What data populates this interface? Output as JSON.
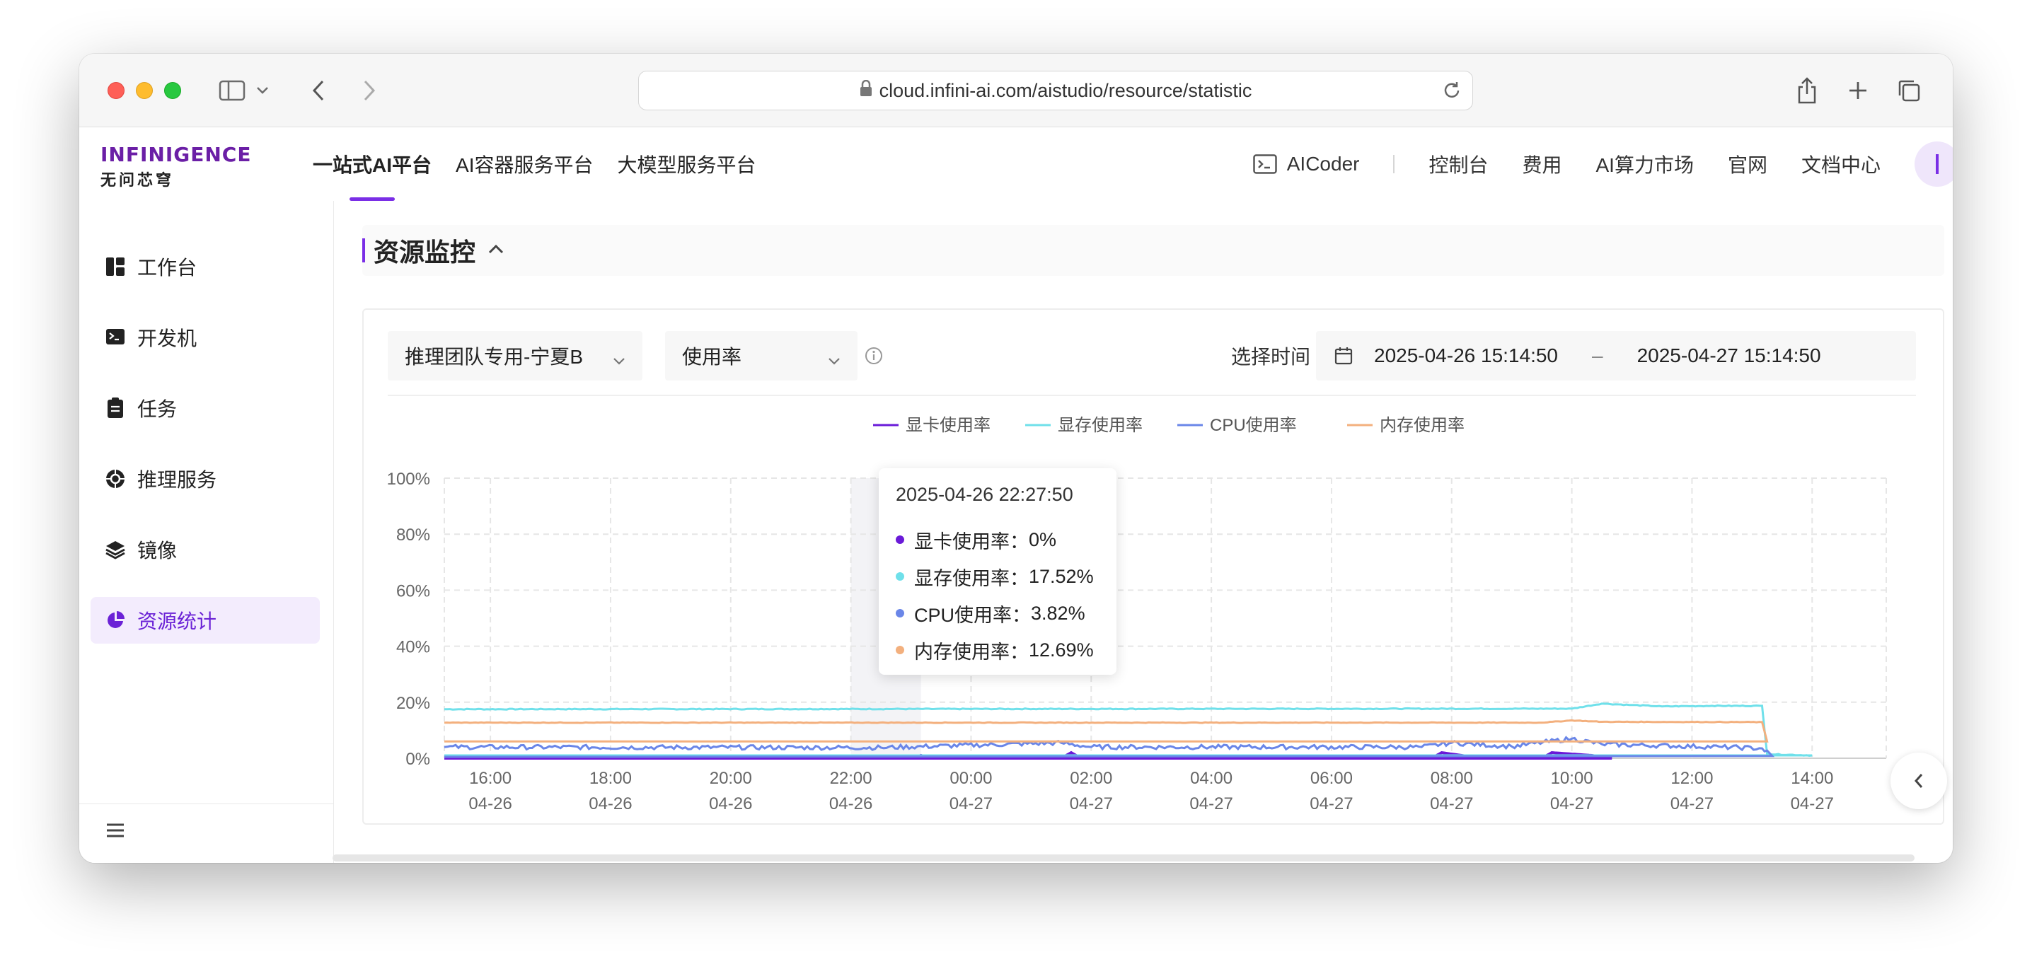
{
  "browser": {
    "url": "cloud.infini-ai.com/aistudio/resource/statistic"
  },
  "header": {
    "logo_main": "INFINIGENCE",
    "logo_sub": "无问芯穹",
    "nav": [
      "一站式AI平台",
      "AI容器服务平台",
      "大模型服务平台"
    ],
    "aicoder": "AICoder",
    "right_links": [
      "控制台",
      "费用",
      "AI算力市场",
      "官网",
      "文档中心"
    ]
  },
  "sidebar": {
    "items": [
      {
        "label": "工作台",
        "icon": "dashboard-icon"
      },
      {
        "label": "开发机",
        "icon": "terminal-icon"
      },
      {
        "label": "任务",
        "icon": "clipboard-icon"
      },
      {
        "label": "推理服务",
        "icon": "inference-icon"
      },
      {
        "label": "镜像",
        "icon": "layers-icon"
      },
      {
        "label": "资源统计",
        "icon": "pie-chart-icon"
      }
    ]
  },
  "section": {
    "title": "资源监控"
  },
  "filters": {
    "cluster": "推理团队专用-宁夏B",
    "metric": "使用率",
    "time_label": "选择时间",
    "start": "2025-04-26 15:14:50",
    "end": "2025-04-27 15:14:50"
  },
  "tooltip": {
    "time": "2025-04-26 22:27:50",
    "rows": [
      {
        "label": "显卡使用率：",
        "value": "0%"
      },
      {
        "label": "显存使用率：",
        "value": "17.52%"
      },
      {
        "label": "CPU使用率：",
        "value": "3.82%"
      },
      {
        "label": "内存使用率：",
        "value": "12.69%"
      }
    ]
  },
  "colors": {
    "accent": "#7a2ee6",
    "gpu": "#6a1ad8",
    "vram": "#6fe0ea",
    "cpu": "#6a86e8",
    "mem": "#f3b07e"
  },
  "chart_data": {
    "type": "line",
    "title": "",
    "xlabel": "",
    "ylabel": "",
    "ylim": [
      0,
      100
    ],
    "y_ticks": [
      "0%",
      "20%",
      "40%",
      "60%",
      "80%",
      "100%"
    ],
    "x_ticks": [
      {
        "time": "16:00",
        "date": "04-26"
      },
      {
        "time": "18:00",
        "date": "04-26"
      },
      {
        "time": "20:00",
        "date": "04-26"
      },
      {
        "time": "22:00",
        "date": "04-26"
      },
      {
        "time": "00:00",
        "date": "04-27"
      },
      {
        "time": "02:00",
        "date": "04-27"
      },
      {
        "time": "04:00",
        "date": "04-27"
      },
      {
        "time": "06:00",
        "date": "04-27"
      },
      {
        "time": "08:00",
        "date": "04-27"
      },
      {
        "time": "10:00",
        "date": "04-27"
      },
      {
        "time": "12:00",
        "date": "04-27"
      },
      {
        "time": "14:00",
        "date": "04-27"
      }
    ],
    "legend_position": "top-center",
    "grid": true,
    "series": [
      {
        "name": "显卡使用率",
        "color": "#6a1ad8",
        "points": [
          [
            "15:14",
            0
          ],
          [
            "23:00",
            0
          ],
          [
            "23:10",
            1
          ],
          [
            "23:20",
            0
          ],
          [
            "01:30",
            0
          ],
          [
            "01:40",
            2
          ],
          [
            "01:50",
            0
          ],
          [
            "07:40",
            0
          ],
          [
            "07:50",
            2
          ],
          [
            "08:10",
            1
          ],
          [
            "08:30",
            0
          ],
          [
            "09:30",
            0
          ],
          [
            "09:40",
            2
          ],
          [
            "10:20",
            1
          ],
          [
            "10:40",
            0
          ],
          [
            "15:14",
            0
          ]
        ]
      },
      {
        "name": "显存使用率",
        "color": "#6fe0ea",
        "points": [
          [
            "15:14",
            17.5
          ],
          [
            "10:00",
            17.7
          ],
          [
            "10:30",
            19.5
          ],
          [
            "11:00",
            19.0
          ],
          [
            "11:30",
            18.5
          ],
          [
            "12:20",
            18.7
          ],
          [
            "13:10",
            18.7
          ],
          [
            "13:15",
            1.5
          ],
          [
            "14:00",
            1.0
          ],
          [
            "15:14",
            1.0
          ]
        ]
      },
      {
        "name": "CPU使用率",
        "color": "#6a86e8",
        "points": [
          [
            "15:14",
            4.0
          ],
          [
            "22:30",
            3.8
          ],
          [
            "01:30",
            5.5
          ],
          [
            "02:00",
            4.0
          ],
          [
            "07:30",
            4.0
          ],
          [
            "08:00",
            5.5
          ],
          [
            "09:00",
            4.2
          ],
          [
            "10:00",
            7.0
          ],
          [
            "10:30",
            5.0
          ],
          [
            "12:30",
            4.0
          ],
          [
            "13:10",
            3.5
          ],
          [
            "13:20",
            0.8
          ],
          [
            "15:14",
            0.5
          ]
        ]
      },
      {
        "name": "内存使用率",
        "color": "#f3b07e",
        "points": [
          [
            "15:14",
            12.7
          ],
          [
            "09:30",
            12.7
          ],
          [
            "10:00",
            13.5
          ],
          [
            "10:30",
            13.0
          ],
          [
            "13:10",
            12.9
          ],
          [
            "13:15",
            6.0
          ],
          [
            "15:14",
            6.0
          ]
        ]
      }
    ]
  }
}
